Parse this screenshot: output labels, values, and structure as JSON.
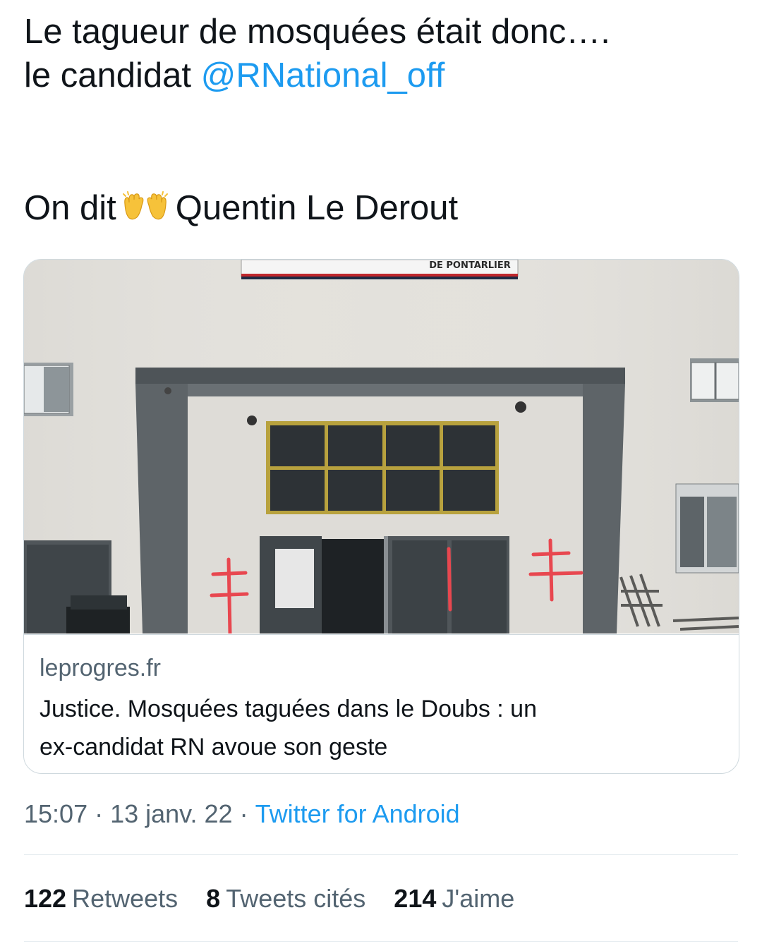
{
  "tweet": {
    "line1": "Le tagueur de mosquées était donc….",
    "line2_prefix": "le candidat ",
    "mention": "@RNational_off",
    "line3_before": "On dit",
    "line3_after": "Quentin Le Derout",
    "emoji_icon": "raising-hands-icon"
  },
  "card": {
    "sign_text": "DE PONTARLIER",
    "domain": "leprogres.fr",
    "title_line1": "Justice. Mosquées taguées dans le Doubs : un",
    "title_line2": "ex-candidat RN avoue son geste"
  },
  "meta": {
    "time": "15:07",
    "date": "13 janv. 22",
    "dot": "·",
    "source": "Twitter for Android"
  },
  "stats": {
    "retweets_count": "122",
    "retweets_label": "Retweets",
    "quotes_count": "8",
    "quotes_label": "Tweets cités",
    "likes_count": "214",
    "likes_label": "J'aime"
  },
  "colors": {
    "text": "#0f1419",
    "secondary": "#536471",
    "link": "#1d9bf0",
    "border": "#cfd9de",
    "graffiti": "#e8474f"
  }
}
